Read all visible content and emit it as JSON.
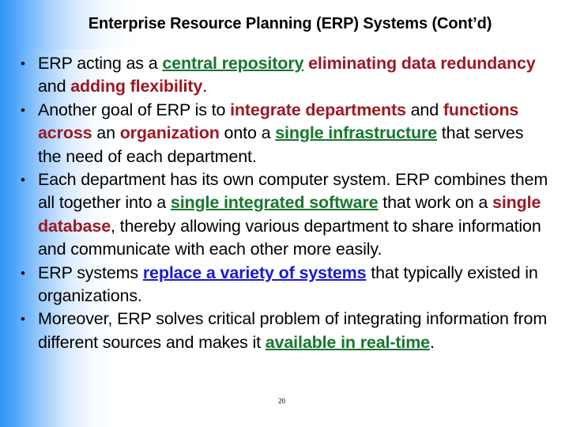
{
  "slide": {
    "title": "Enterprise Resource Planning (ERP) Systems (Cont’d)",
    "page_number": "20",
    "colors": {
      "accent_blue_gradient": "#2f93f7",
      "emphasis_green": "#17762f",
      "emphasis_red": "#9c1823",
      "emphasis_blue": "#1a1ad2",
      "text": "#000000",
      "background": "#ffffff"
    },
    "bullets": [
      {
        "id": "bullet-1",
        "segments": [
          {
            "text": "ERP acting as a ",
            "style": "plain"
          },
          {
            "text": "central repository",
            "style": "green-underline"
          },
          {
            "text": " ",
            "style": "plain"
          },
          {
            "text": "eliminating data redundancy",
            "style": "red-bold"
          },
          {
            "text": " and ",
            "style": "plain"
          },
          {
            "text": "adding flexibility",
            "style": "red-bold"
          },
          {
            "text": ".",
            "style": "plain"
          }
        ]
      },
      {
        "id": "bullet-2",
        "segments": [
          {
            "text": "Another goal of ERP is to ",
            "style": "plain"
          },
          {
            "text": "integrate departments",
            "style": "red-bold"
          },
          {
            "text": " and ",
            "style": "plain"
          },
          {
            "text": "functions across",
            "style": "red-bold"
          },
          {
            "text": " an ",
            "style": "plain"
          },
          {
            "text": "organization",
            "style": "red-bold"
          },
          {
            "text": " onto a ",
            "style": "plain"
          },
          {
            "text": "single infrastructure",
            "style": "green-underline"
          },
          {
            "text": " that serves the need of each department.",
            "style": "plain"
          }
        ]
      },
      {
        "id": "bullet-3",
        "segments": [
          {
            "text": "Each department has its own computer system. ERP combines them all together into a ",
            "style": "plain"
          },
          {
            "text": "single integrated software",
            "style": "green-underline"
          },
          {
            "text": " that work on a ",
            "style": "plain"
          },
          {
            "text": "single database",
            "style": "red-bold"
          },
          {
            "text": ", thereby allowing various department to share information and communicate with each other more easily.",
            "style": "plain"
          }
        ]
      },
      {
        "id": "bullet-4",
        "segments": [
          {
            "text": "ERP systems ",
            "style": "plain"
          },
          {
            "text": "replace a variety of systems",
            "style": "blue-underline"
          },
          {
            "text": " that typically existed in organizations.",
            "style": "plain"
          }
        ]
      },
      {
        "id": "bullet-5",
        "segments": [
          {
            "text": "Moreover, ERP solves critical problem of integrating information from different sources and makes it ",
            "style": "plain"
          },
          {
            "text": "available in real-time",
            "style": "green-underline"
          },
          {
            "text": ".",
            "style": "plain"
          }
        ]
      }
    ]
  }
}
